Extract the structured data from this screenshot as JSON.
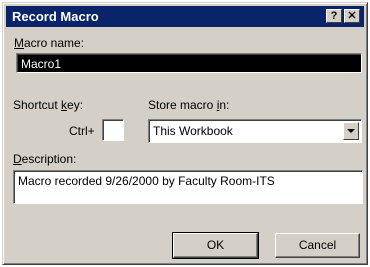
{
  "window": {
    "title": "Record Macro",
    "help_label": "?",
    "close_label": "✕"
  },
  "macro_name": {
    "label": "Macro name:",
    "value": "Macro1"
  },
  "shortcut": {
    "label": "Shortcut key:",
    "modifier": "Ctrl+",
    "value": ""
  },
  "store": {
    "label": "Store macro in:",
    "selected": "This Workbook"
  },
  "description": {
    "label": "Description:",
    "value": "Macro recorded 9/26/2000 by Faculty Room-ITS"
  },
  "buttons": {
    "ok": "OK",
    "cancel": "Cancel"
  },
  "colors": {
    "titlebar": "#0a246a",
    "dialog_bg": "#d4d0c8"
  }
}
